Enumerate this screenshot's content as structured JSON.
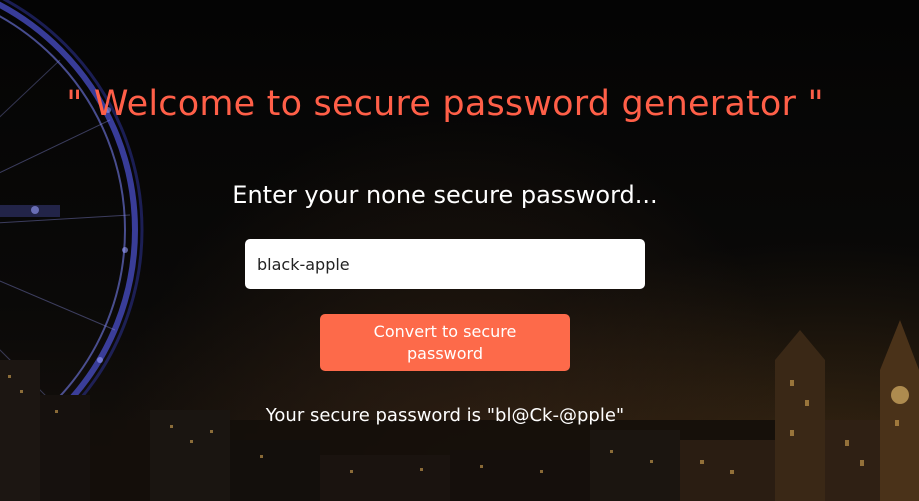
{
  "heading": {
    "welcome": "\" Welcome to secure password generator \"",
    "prompt": "Enter your none secure password..."
  },
  "form": {
    "password_value": "black-apple",
    "convert_button_label": "Convert to secure password"
  },
  "result": {
    "text": "Your secure password is \"bl@Ck-@pple\""
  },
  "colors": {
    "heading": "#ff5f48",
    "button": "#fd6a4a",
    "text": "#ffffff"
  },
  "background": {
    "description_icon": "london-night-skyline-background"
  }
}
